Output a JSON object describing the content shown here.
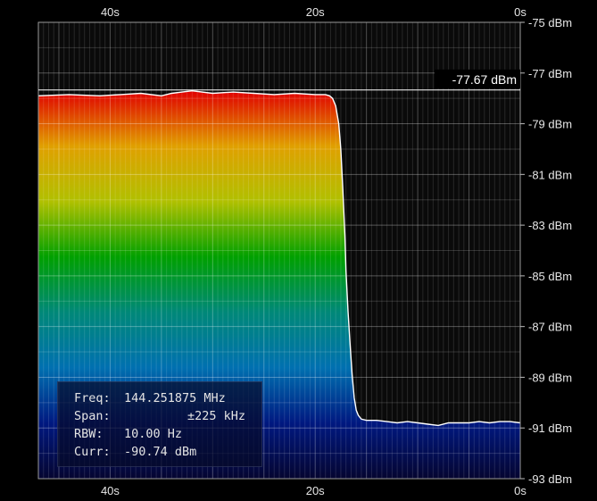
{
  "chart_data": {
    "type": "area",
    "title": "",
    "xlabel": "",
    "ylabel": "",
    "x_unit": "s",
    "x_ticks": [
      "40s",
      "20s",
      "0s"
    ],
    "y_ticks": [
      "-75 dBm",
      "-77 dBm",
      "-79 dBm",
      "-81 dBm",
      "-83 dBm",
      "-85 dBm",
      "-87 dBm",
      "-89 dBm",
      "-91 dBm",
      "-93 dBm"
    ],
    "xlim": [
      47,
      0
    ],
    "ylim": [
      -93,
      -75
    ],
    "grid": true,
    "fill_gradient": [
      "#e00000",
      "#e0a000",
      "#b0c000",
      "#00a000",
      "#008878",
      "#0070b0",
      "#001880",
      "#050530"
    ],
    "series": [
      {
        "line_color": "#ffffff",
        "x": [
          47,
          44,
          41,
          39,
          37,
          35,
          34,
          33,
          32,
          30,
          28,
          26,
          24,
          22,
          20,
          19,
          18.6,
          18.3,
          18,
          17.7,
          17.5,
          17.3,
          17.1,
          17,
          16.8,
          16.6,
          16.4,
          16.2,
          16,
          15.8,
          15.5,
          15,
          14,
          13,
          12,
          11,
          10,
          9,
          8,
          7,
          6,
          5,
          4,
          3,
          2,
          1,
          0
        ],
        "y": [
          -77.9,
          -77.85,
          -77.9,
          -77.85,
          -77.8,
          -77.9,
          -77.8,
          -77.75,
          -77.7,
          -77.8,
          -77.75,
          -77.8,
          -77.85,
          -77.8,
          -77.85,
          -77.85,
          -77.9,
          -78.0,
          -78.3,
          -79.0,
          -80.0,
          -81.6,
          -83.4,
          -84.8,
          -86.4,
          -87.7,
          -88.9,
          -89.8,
          -90.3,
          -90.5,
          -90.65,
          -90.7,
          -90.7,
          -90.75,
          -90.8,
          -90.75,
          -90.8,
          -90.85,
          -90.9,
          -90.8,
          -90.8,
          -90.8,
          -90.75,
          -90.8,
          -90.75,
          -90.75,
          -90.8
        ]
      }
    ],
    "marker": {
      "value": -77.67,
      "label": "-77.67 dBm"
    }
  },
  "info_panel": {
    "freq_label": "Freq:",
    "freq_value": "144.251875 MHz",
    "span_label": "Span:",
    "span_value": "±225 kHz",
    "rbw_label": "RBW:",
    "rbw_value": "10.00 Hz",
    "curr_label": "Curr:",
    "curr_value": "-90.74 dBm"
  }
}
